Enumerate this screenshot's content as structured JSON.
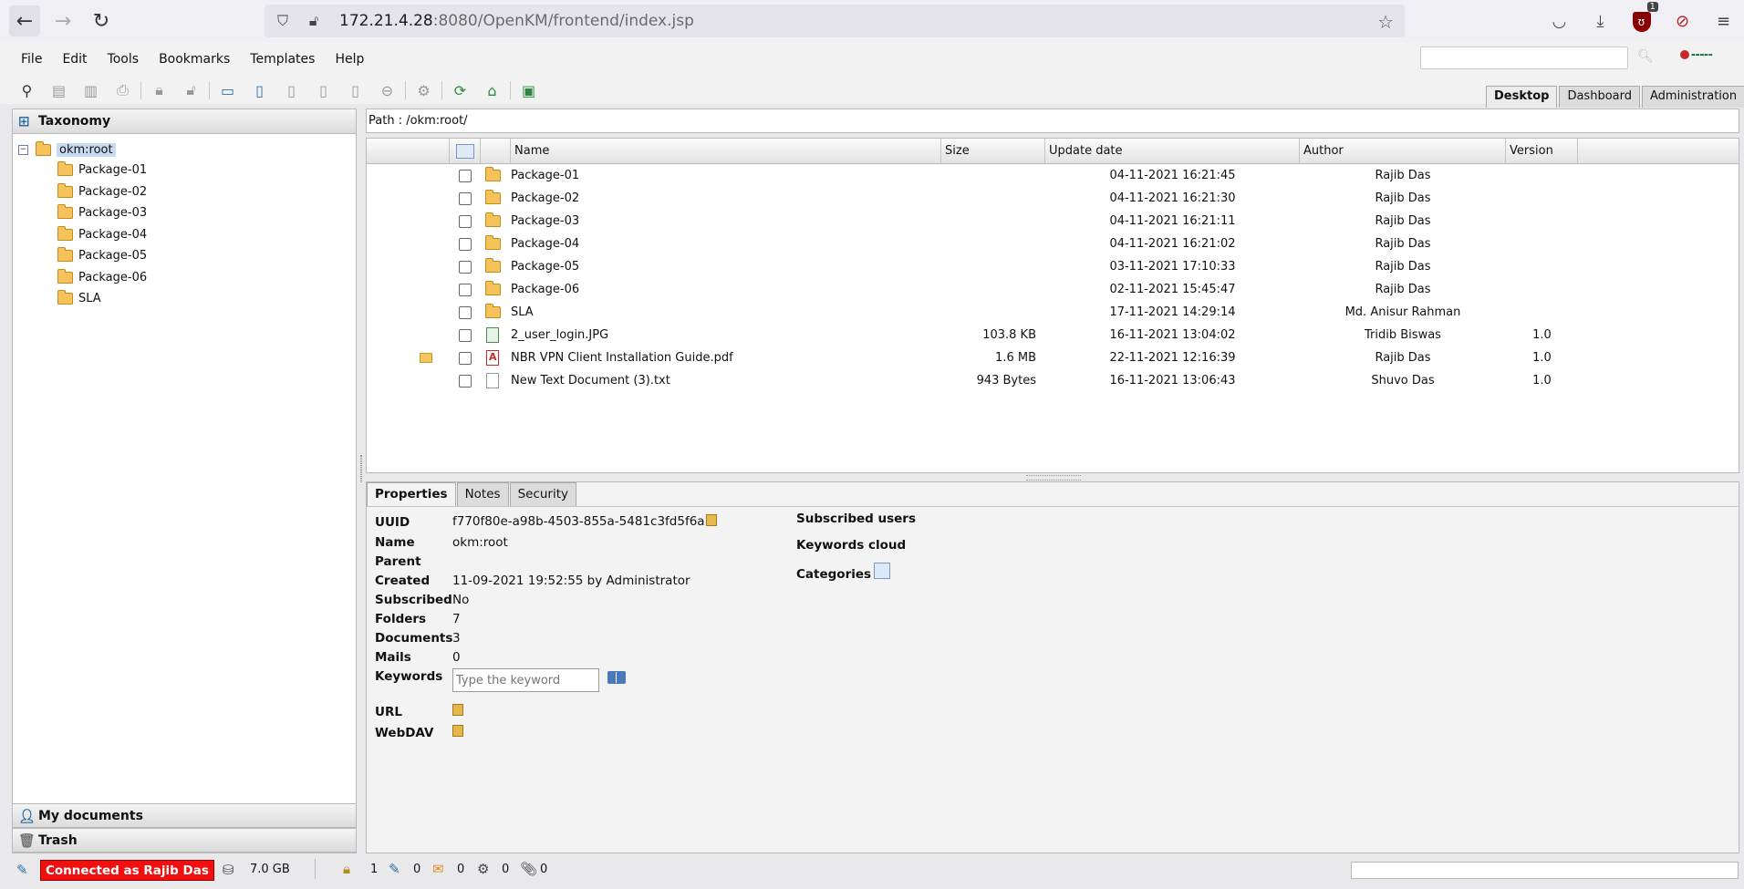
{
  "browser": {
    "url_host": "172.21.4.28",
    "url_path": ":8080/OpenKM/frontend/index.jsp",
    "extension_badge": "1"
  },
  "menu": [
    "File",
    "Edit",
    "Tools",
    "Bookmarks",
    "Templates",
    "Help"
  ],
  "workspace_tabs": [
    "Desktop",
    "Dashboard",
    "Administration"
  ],
  "left": {
    "taxonomy_label": "Taxonomy",
    "root": "okm:root",
    "folders": [
      "Package-01",
      "Package-02",
      "Package-03",
      "Package-04",
      "Package-05",
      "Package-06",
      "SLA"
    ],
    "my_documents_label": "My documents",
    "trash_label": "Trash"
  },
  "path": "Path : /okm:root/",
  "grid": {
    "headers": {
      "name": "Name",
      "size": "Size",
      "date": "Update date",
      "author": "Author",
      "version": "Version"
    },
    "rows": [
      {
        "name": "Package-01",
        "size": "",
        "date": "04-11-2021 16:21:45",
        "author": "Rajib Das",
        "version": "",
        "kind": "folder"
      },
      {
        "name": "Package-02",
        "size": "",
        "date": "04-11-2021 16:21:30",
        "author": "Rajib Das",
        "version": "",
        "kind": "folder"
      },
      {
        "name": "Package-03",
        "size": "",
        "date": "04-11-2021 16:21:11",
        "author": "Rajib Das",
        "version": "",
        "kind": "folder"
      },
      {
        "name": "Package-04",
        "size": "",
        "date": "04-11-2021 16:21:02",
        "author": "Rajib Das",
        "version": "",
        "kind": "folder"
      },
      {
        "name": "Package-05",
        "size": "",
        "date": "03-11-2021 17:10:33",
        "author": "Rajib Das",
        "version": "",
        "kind": "folder"
      },
      {
        "name": "Package-06",
        "size": "",
        "date": "02-11-2021 15:45:47",
        "author": "Rajib Das",
        "version": "",
        "kind": "folder"
      },
      {
        "name": "SLA",
        "size": "",
        "date": "17-11-2021 14:29:14",
        "author": "Md. Anisur Rahman",
        "version": "",
        "kind": "folder"
      },
      {
        "name": "2_user_login.JPG",
        "size": "103.8 KB",
        "date": "16-11-2021 13:04:02",
        "author": "Tridib Biswas",
        "version": "1.0",
        "kind": "image"
      },
      {
        "name": "NBR VPN Client Installation Guide.pdf",
        "size": "1.6 MB",
        "date": "22-11-2021 12:16:39",
        "author": "Rajib Das",
        "version": "1.0",
        "kind": "pdf"
      },
      {
        "name": "New Text Document (3).txt",
        "size": "943 Bytes",
        "date": "16-11-2021 13:06:43",
        "author": "Shuvo Das",
        "version": "1.0",
        "kind": "text"
      }
    ]
  },
  "props": {
    "tabs": [
      "Properties",
      "Notes",
      "Security"
    ],
    "labels": {
      "uuid": "UUID",
      "name": "Name",
      "parent": "Parent",
      "created": "Created",
      "subscribed": "Subscribed",
      "folders": "Folders",
      "documents": "Documents",
      "mails": "Mails",
      "keywords": "Keywords",
      "url": "URL",
      "webdav": "WebDAV"
    },
    "values": {
      "uuid": "f770f80e-a98b-4503-855a-5481c3fd5f6a",
      "name": "okm:root",
      "parent": "",
      "created": "11-09-2021 19:52:55 by Administrator",
      "subscribed": "No",
      "folders": "7",
      "documents": "3",
      "mails": "0"
    },
    "keyword_placeholder": "Type the keyword",
    "right_labels": {
      "subscribed_users": "Subscribed users",
      "keywords_cloud": "Keywords cloud",
      "categories": "Categories"
    }
  },
  "status": {
    "connected": "Connected as Rajib Das",
    "disk": "7.0 GB",
    "locked": "1",
    "checkout": "0",
    "messages": "0",
    "tasks": "0",
    "attachments": "0"
  },
  "colors": {
    "connected_bg": "#f10f0f",
    "selection": "#c9dbf1"
  }
}
